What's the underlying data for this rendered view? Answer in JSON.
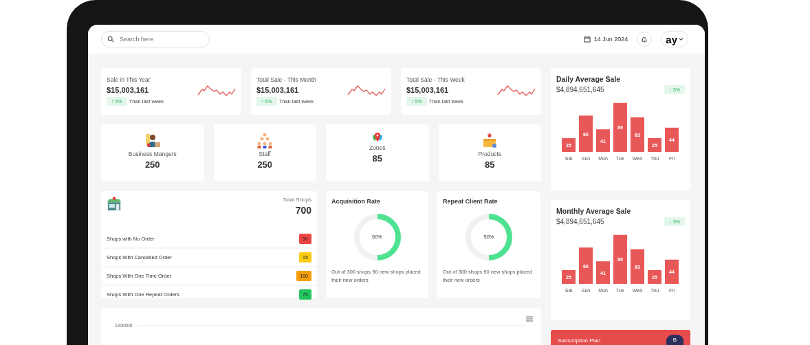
{
  "header": {
    "search": {
      "placeholder": "Search here"
    },
    "date": "14 Jun 2024",
    "profile": "ay"
  },
  "stat_cards": [
    {
      "title": "Sale in This Year",
      "value": "$15,003,161",
      "change": "↑ 5%",
      "note": "Than last week"
    },
    {
      "title": "Total Sale - This Month",
      "value": "$15,003,161",
      "change": "↑ 5%",
      "note": "Than last week"
    },
    {
      "title": "Total Sale - This Week",
      "value": "$15,003,161",
      "change": "↑ 5%",
      "note": "Than last week"
    }
  ],
  "count_cards": [
    {
      "kind": "manager",
      "label": "Business Mangers",
      "value": "250"
    },
    {
      "kind": "staff",
      "label": "Staff",
      "value": "250"
    },
    {
      "kind": "zones",
      "label": "Zones",
      "value": "85"
    },
    {
      "kind": "products",
      "label": "Products",
      "value": "85"
    }
  ],
  "shops": {
    "title": "Total Shops",
    "total": "700",
    "rows": [
      {
        "label": "Shops with No Order",
        "count": "50",
        "color": "#ef4444"
      },
      {
        "label": "Shops With Cancelled Order",
        "count": "15",
        "color": "#facc15"
      },
      {
        "label": "Shops With One Time Order",
        "count": "100",
        "color": "#f59e0b"
      },
      {
        "label": "Shops With One Repeat Orders",
        "count": "75",
        "color": "#22c55e"
      }
    ]
  },
  "rate_cards": [
    {
      "title": "Acquisition Rate",
      "level": 0.5,
      "reading": "50%",
      "note": "Out of 300 shops 90 new shops placed their new orders"
    },
    {
      "title": "Repeat Client Rate",
      "level": 0.5,
      "reading": "50%",
      "note": "Out of 300 shops 90 new shops placed their new orders"
    }
  ],
  "sales_chart": {
    "tick_label": "1200000"
  },
  "average_cards": [
    {
      "title": "Daily Average Sale",
      "value": "$4,894,651,645",
      "change": "↑ 5%",
      "chart_data": {
        "type": "bar",
        "categories": [
          "Sat",
          "Sun",
          "Mon",
          "Tue",
          "Wed",
          "Thu",
          "Fri"
        ],
        "values": [
          25,
          66,
          41,
          89,
          63,
          25,
          44
        ],
        "data_labels": true
      }
    },
    {
      "title": "Monthly Average Sale",
      "value": "$4,894,651,645",
      "change": "↑ 5%",
      "chart_data": {
        "type": "bar",
        "categories": [
          "Sat",
          "Sun",
          "Mon",
          "Tue",
          "Wed",
          "Thu",
          "Fri"
        ],
        "values": [
          25,
          66,
          41,
          89,
          63,
          25,
          44
        ],
        "data_labels": true
      }
    }
  ],
  "subscription": {
    "title": "Subscription Plan",
    "button": "B"
  }
}
